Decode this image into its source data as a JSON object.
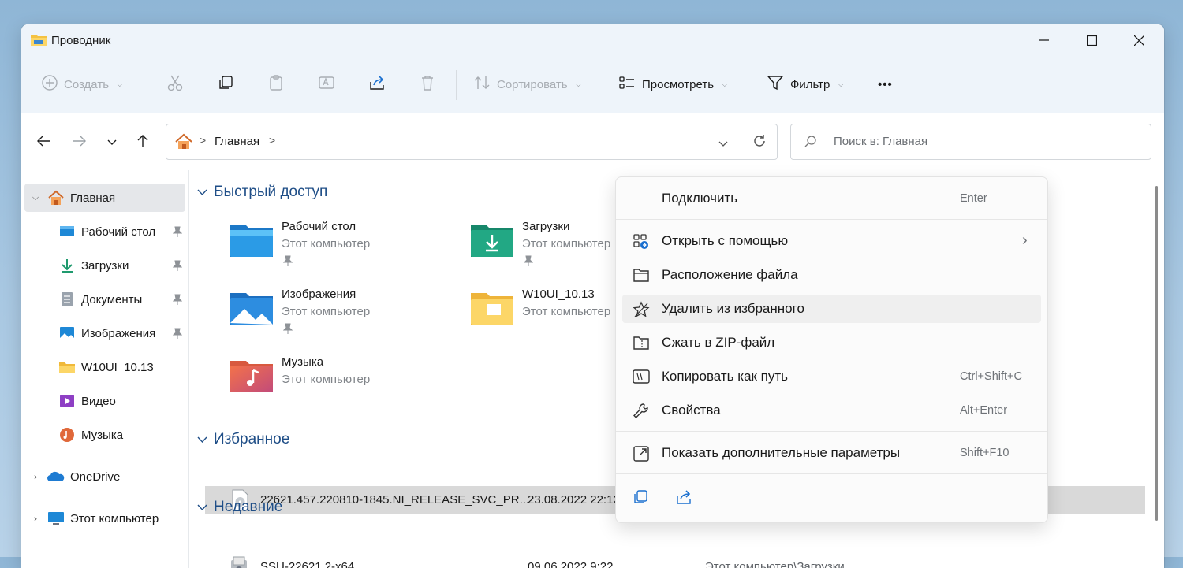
{
  "window": {
    "title": "Проводник"
  },
  "toolbar": {
    "create_label": "Создать",
    "sort_label": "Сортировать",
    "view_label": "Просмотреть",
    "filter_label": "Фильтр",
    "more_label": "•••"
  },
  "address": {
    "home_label": "Главная",
    "separator": ">"
  },
  "search": {
    "placeholder": "Поиск в: Главная"
  },
  "sidebar": {
    "items": [
      {
        "label": "Главная",
        "icon": "home-icon"
      },
      {
        "label": "Рабочий стол",
        "icon": "desktop-icon"
      },
      {
        "label": "Загрузки",
        "icon": "download-icon"
      },
      {
        "label": "Документы",
        "icon": "documents-icon"
      },
      {
        "label": "Изображения",
        "icon": "pictures-icon"
      },
      {
        "label": "W10UI_10.13",
        "icon": "folder-icon"
      },
      {
        "label": "Видео",
        "icon": "video-icon"
      },
      {
        "label": "Музыка",
        "icon": "music-icon"
      },
      {
        "label": "OneDrive",
        "icon": "onedrive-icon"
      },
      {
        "label": "Этот компьютер",
        "icon": "computer-icon"
      }
    ]
  },
  "quick_access": {
    "heading": "Быстрый доступ",
    "items": [
      {
        "name": "Рабочий стол",
        "location": "Этот компьютер",
        "icon": "desktop-folder-icon"
      },
      {
        "name": "Загрузки",
        "location": "Этот компьютер",
        "icon": "downloads-folder-icon"
      },
      {
        "name": "Изображения",
        "location": "Этот компьютер",
        "icon": "pictures-folder-icon"
      },
      {
        "name": "W10UI_10.13",
        "location": "Этот компьютер",
        "icon": "plain-folder-icon"
      },
      {
        "name": "Музыка",
        "location": "Этот компьютер",
        "icon": "music-folder-icon"
      }
    ]
  },
  "favorites": {
    "heading": "Избранное",
    "rows": [
      {
        "name": "22621.457.220810-1845.NI_RELEASE_SVC_PR...",
        "date": "23.08.2022 22:12"
      }
    ]
  },
  "recent": {
    "heading": "Недавние",
    "rows": [
      {
        "name": "SSU-22621.2-x64",
        "date": "09.06.2022 9:22",
        "location": "Этот компьютер\\Загрузки"
      }
    ]
  },
  "context_menu": {
    "items": [
      {
        "label": "Подключить",
        "shortcut": "Enter"
      },
      {
        "label": "Открыть с помощью",
        "submenu_arrow": "›",
        "icon": "open-with-icon"
      },
      {
        "label": "Расположение файла",
        "icon": "folder-outline-icon"
      },
      {
        "label": "Удалить из избранного",
        "icon": "star-outline-icon"
      },
      {
        "label": "Сжать в ZIP-файл",
        "icon": "zip-icon"
      },
      {
        "label": "Копировать как путь",
        "shortcut": "Ctrl+Shift+C",
        "icon": "copy-path-icon"
      },
      {
        "label": "Свойства",
        "shortcut": "Alt+Enter",
        "icon": "wrench-icon"
      },
      {
        "label": "Показать дополнительные параметры",
        "shortcut": "Shift+F10",
        "icon": "more-options-icon"
      }
    ],
    "bottom_icons": [
      "copy-icon",
      "share-icon"
    ]
  },
  "colors": {
    "accent": "#1f4e87",
    "selection": "#d9d9d9",
    "toolbar_bg": "#eef4fa"
  }
}
